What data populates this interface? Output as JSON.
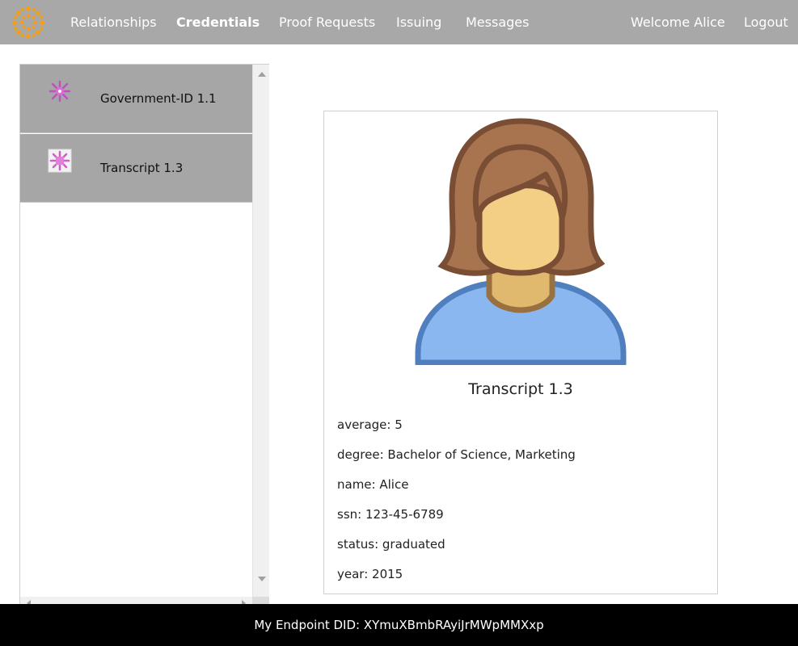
{
  "nav": {
    "items": [
      {
        "label": "Relationships",
        "active": false
      },
      {
        "label": "Credentials",
        "active": true
      },
      {
        "label": "Proof Requests",
        "active": false
      },
      {
        "label": "Issuing",
        "active": false
      },
      {
        "label": "Messages",
        "active": false
      }
    ],
    "welcome": "Welcome Alice",
    "logout": "Logout",
    "logo_icon": "orange-sunburst-logo",
    "colors": {
      "bar": "#a8a8a8",
      "text": "#ffffff",
      "logo": "#f0a020"
    }
  },
  "sidebar": {
    "items": [
      {
        "label": "Government-ID 1.1",
        "icon": "credential-thumbnail-icon"
      },
      {
        "label": "Transcript 1.3",
        "icon": "credential-thumbnail-icon"
      }
    ],
    "item_bg": "#a6a6a6"
  },
  "detail": {
    "avatar_icon": "female-user-avatar",
    "title": "Transcript 1.3",
    "attributes": [
      {
        "name": "average",
        "value": "5"
      },
      {
        "name": "degree",
        "value": "Bachelor of Science, Marketing"
      },
      {
        "name": "name",
        "value": "Alice"
      },
      {
        "name": "ssn",
        "value": "123-45-6789"
      },
      {
        "name": "status",
        "value": "graduated"
      },
      {
        "name": "year",
        "value": "2015"
      }
    ]
  },
  "footer": {
    "text": "My Endpoint DID: XYmuXBmbRAyiJrMWpMMXxp",
    "bg": "#000000"
  }
}
